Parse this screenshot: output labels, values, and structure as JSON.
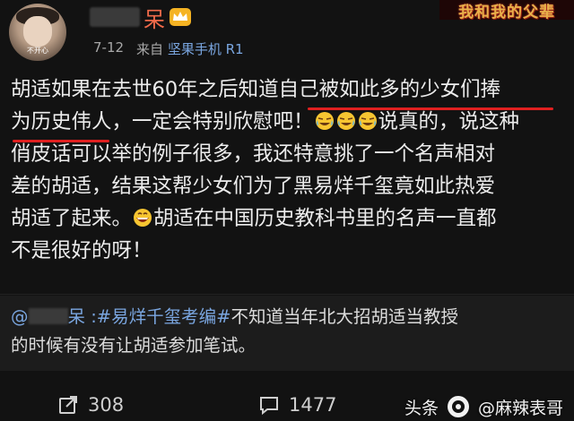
{
  "header": {
    "avatar_caption": "不开心",
    "username_suffix": "呆",
    "date": "7-12",
    "source_prefix": "来自",
    "device": "坚果手机 R1",
    "banner_text": "我和我的父辈"
  },
  "post": {
    "lines": [
      "胡适如果在去世60年之后知道自己被如此多的少女们捧",
      "为历史伟人，一定会特别欣慰吧！",
      "说真的，说这种",
      "俏皮话可以举的例子很多，我还特意挑了一个名声相对",
      "差的胡适，结果这帮少女们为了黑易烊千玺竟如此热爱",
      "胡适了起来。",
      "胡适在中国历史教科书里的名声一直都",
      "不是很好的呀！"
    ]
  },
  "repost": {
    "mention_prefix": "@",
    "mention_suffix": "呆",
    "separator": " :",
    "hashtag": "#易烊千玺考编#",
    "line1_rest": "不知道当年北大招胡适当教授",
    "line2": "的时候有没有让胡适参加笔试。"
  },
  "footer": {
    "share_count": "308",
    "comment_count": "1477"
  },
  "watermark": {
    "prefix": "头条",
    "name": "@麻辣表哥"
  },
  "colors": {
    "background": "#121212",
    "username": "#f06a4a",
    "link": "#7aa6e0",
    "underline": "#e02020"
  },
  "icons": [
    "crown-icon",
    "laugh-cry-emoji",
    "grin-emoji",
    "share-icon",
    "comment-icon",
    "toutiao-logo-icon"
  ]
}
